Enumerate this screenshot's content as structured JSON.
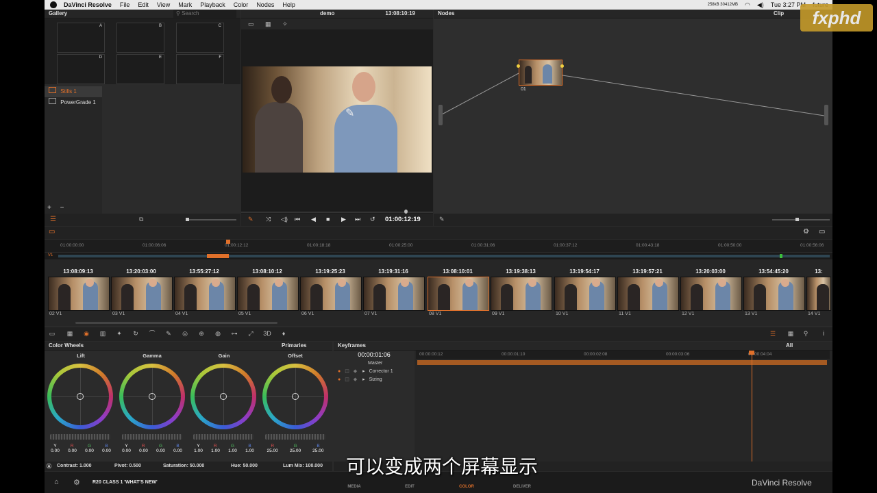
{
  "menubar": {
    "app": "DaVinci Resolve",
    "items": [
      "File",
      "Edit",
      "View",
      "Mark",
      "Playback",
      "Color",
      "Nodes",
      "Help"
    ],
    "clock": "Tue 3:27 PM",
    "user": "future",
    "net": "258kB 30412MB"
  },
  "gallery": {
    "title": "Gallery",
    "search_placeholder": "Search",
    "stills": [
      "A",
      "B",
      "C",
      "D",
      "E",
      "F"
    ],
    "albums": [
      "Stills 1",
      "PowerGrade 1"
    ]
  },
  "viewer": {
    "clip_name": "demo",
    "timecode": "13:08:10:19",
    "playhead_tc": "01:00:12:19"
  },
  "nodes": {
    "title": "Nodes",
    "mode": "Clip",
    "node_label": "01"
  },
  "logo": "fxphd",
  "timeline": {
    "ruler": [
      "01:00:00:00",
      "01:00:06:06",
      "01:00:12:12",
      "01:00:18:18",
      "01:00:25:00",
      "01:00:31:06",
      "01:00:37:12",
      "01:00:43:18",
      "01:00:50:00",
      "01:00:56:06"
    ],
    "track_label": "V1"
  },
  "clips": [
    {
      "tc": "13:08:09:13",
      "num": "02",
      "track": "V1"
    },
    {
      "tc": "13:20:03:00",
      "num": "03",
      "track": "V1"
    },
    {
      "tc": "13:55:27:12",
      "num": "04",
      "track": "V1"
    },
    {
      "tc": "13:08:10:12",
      "num": "05",
      "track": "V1"
    },
    {
      "tc": "13:19:25:23",
      "num": "06",
      "track": "V1"
    },
    {
      "tc": "13:19:31:16",
      "num": "07",
      "track": "V1"
    },
    {
      "tc": "13:08:10:01",
      "num": "08",
      "track": "V1"
    },
    {
      "tc": "13:19:38:13",
      "num": "09",
      "track": "V1"
    },
    {
      "tc": "13:19:54:17",
      "num": "10",
      "track": "V1"
    },
    {
      "tc": "13:19:57:21",
      "num": "11",
      "track": "V1"
    },
    {
      "tc": "13:20:03:00",
      "num": "12",
      "track": "V1"
    },
    {
      "tc": "13:54:45:20",
      "num": "13",
      "track": "V1"
    },
    {
      "tc": "13:",
      "num": "14",
      "track": "V1"
    }
  ],
  "color_wheels": {
    "title": "Color Wheels",
    "mode": "Primaries",
    "wheels": [
      {
        "name": "Lift",
        "vals": [
          "0.00",
          "0.00",
          "0.00",
          "0.00"
        ]
      },
      {
        "name": "Gamma",
        "vals": [
          "0.00",
          "0.00",
          "0.00",
          "0.00"
        ]
      },
      {
        "name": "Gain",
        "vals": [
          "1.00",
          "1.00",
          "1.00",
          "1.00"
        ]
      },
      {
        "name": "Offset",
        "vals": [
          "25.00",
          "25.00",
          "25.00"
        ]
      }
    ],
    "channel_labels": [
      "Y",
      "R",
      "G",
      "B"
    ],
    "offset_channel_labels": [
      "R",
      "G",
      "B"
    ],
    "contrast": "Contrast: 1.000",
    "pivot": "Pivot: 0.500",
    "saturation": "Saturation: 50.000",
    "hue": "Hue: 50.000",
    "lum_mix": "Lum Mix: 100.000"
  },
  "keyframes": {
    "title": "Keyframes",
    "filter": "All",
    "timecode": "00:00:01:06",
    "ruler": [
      "00:00:00:12",
      "00:00:01:10",
      "00:00:02:08",
      "00:00:03:06",
      "00:00:04:04"
    ],
    "tracks": [
      "Master",
      "Corrector 1",
      "Sizing"
    ]
  },
  "bottom": {
    "project": "R20 CLASS 1 'WHAT'S NEW'",
    "tabs": [
      "MEDIA",
      "EDIT",
      "COLOR",
      "DELIVER"
    ],
    "brand": "DaVinci Resolve",
    "subtitle": "可以变成两个屏幕显示"
  },
  "colors": {
    "accent": "#e0702a",
    "panel": "#2b2b2b"
  }
}
